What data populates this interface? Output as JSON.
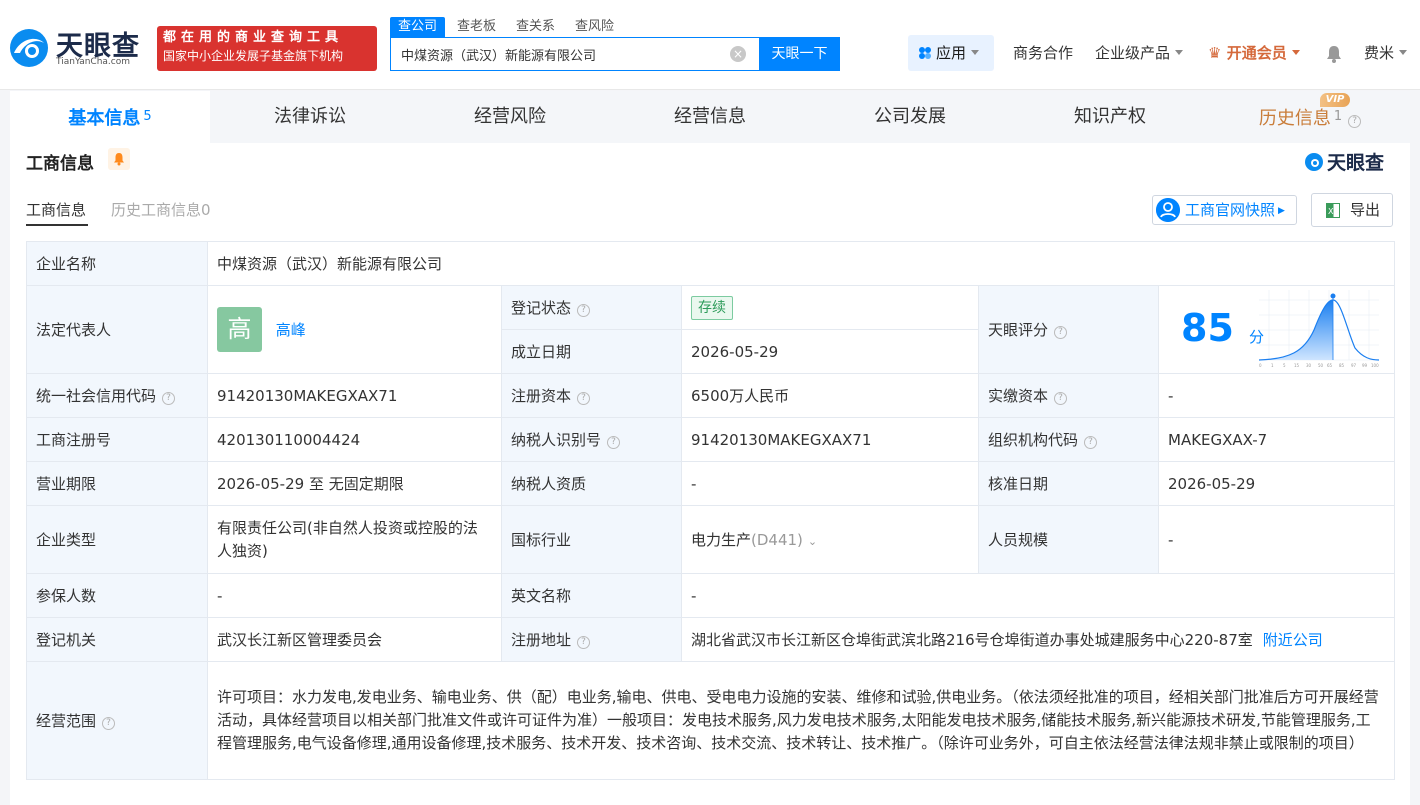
{
  "header": {
    "logo_text": "天眼查",
    "logo_sub": "TianYanCha.com",
    "slogan_line1": "都在用的商业查询工具",
    "slogan_line2": "国家中小企业发展子基金旗下机构",
    "search_tabs": [
      "查公司",
      "查老板",
      "查关系",
      "查风险"
    ],
    "search_value": "中煤资源（武汉）新能源有限公司",
    "search_clear": "×",
    "search_button": "天眼一下",
    "app_label": "应用",
    "nav": [
      "商务合作",
      "企业级产品",
      "开通会员",
      "费米"
    ]
  },
  "tabs": {
    "items": [
      "基本信息",
      "法律诉讼",
      "经营风险",
      "经营信息",
      "公司发展",
      "知识产权",
      "历史信息"
    ],
    "basic_count": "5",
    "history_count": "1",
    "vip": "VIP"
  },
  "section": {
    "title": "工商信息",
    "brand": "天眼查",
    "subtabs": [
      "工商信息",
      "历史工商信息0"
    ],
    "snapshot_btn": "工商官网快照",
    "export_btn": "导出"
  },
  "table": {
    "company_name_k": "企业名称",
    "company_name_v": "中煤资源（武汉）新能源有限公司",
    "legal_rep_k": "法定代表人",
    "legal_rep_avatar": "高",
    "legal_rep_v": "高峰",
    "reg_status_k": "登记状态",
    "reg_status_v": "存续",
    "est_date_k": "成立日期",
    "est_date_v": "2026-05-29",
    "score_k": "天眼评分",
    "score_v": "85",
    "score_unit": "分",
    "score_axis": [
      "0",
      "1",
      "5",
      "15",
      "30",
      "50",
      "65",
      "85",
      "97",
      "99",
      "100"
    ],
    "credit_code_k": "统一社会信用代码",
    "credit_code_v": "91420130MAKEGXAX71",
    "reg_capital_k": "注册资本",
    "reg_capital_v": "6500万人民币",
    "paid_capital_k": "实缴资本",
    "paid_capital_v": "-",
    "reg_no_k": "工商注册号",
    "reg_no_v": "420130110004424",
    "tax_id_k": "纳税人识别号",
    "tax_id_v": "91420130MAKEGXAX71",
    "org_code_k": "组织机构代码",
    "org_code_v": "MAKEGXAX-7",
    "term_k": "营业期限",
    "term_v": "2026-05-29 至 无固定期限",
    "tax_qual_k": "纳税人资质",
    "tax_qual_v": "-",
    "approve_date_k": "核准日期",
    "approve_date_v": "2026-05-29",
    "type_k": "企业类型",
    "type_v": "有限责任公司(非自然人投资或控股的法人独资)",
    "industry_k": "国标行业",
    "industry_v": "电力生产",
    "industry_code": "(D441)",
    "staff_k": "人员规模",
    "staff_v": "-",
    "insured_k": "参保人数",
    "insured_v": "-",
    "en_name_k": "英文名称",
    "en_name_v": "-",
    "authority_k": "登记机关",
    "authority_v": "武汉长江新区管理委员会",
    "address_k": "注册地址",
    "address_v": "湖北省武汉市长江新区仓埠街武滨北路216号仓埠街道办事处城建服务中心220-87室",
    "nearby": "附近公司",
    "scope_k": "经营范围",
    "scope_v": "许可项目：水力发电,发电业务、输电业务、供（配）电业务,输电、供电、受电电力设施的安装、维修和试验,供电业务。（依法须经批准的项目，经相关部门批准后方可开展经营活动，具体经营项目以相关部门批准文件或许可证件为准）一般项目：发电技术服务,风力发电技术服务,太阳能发电技术服务,储能技术服务,新兴能源技术研发,节能管理服务,工程管理服务,电气设备修理,通用设备修理,技术服务、技术开发、技术咨询、技术交流、技术转让、技术推广。（除许可业务外，可自主依法经营法律法规非禁止或限制的项目）"
  },
  "colors": {
    "accent": "#0084ff",
    "vip": "#d5693b",
    "key_bg": "#f2f7fd"
  }
}
